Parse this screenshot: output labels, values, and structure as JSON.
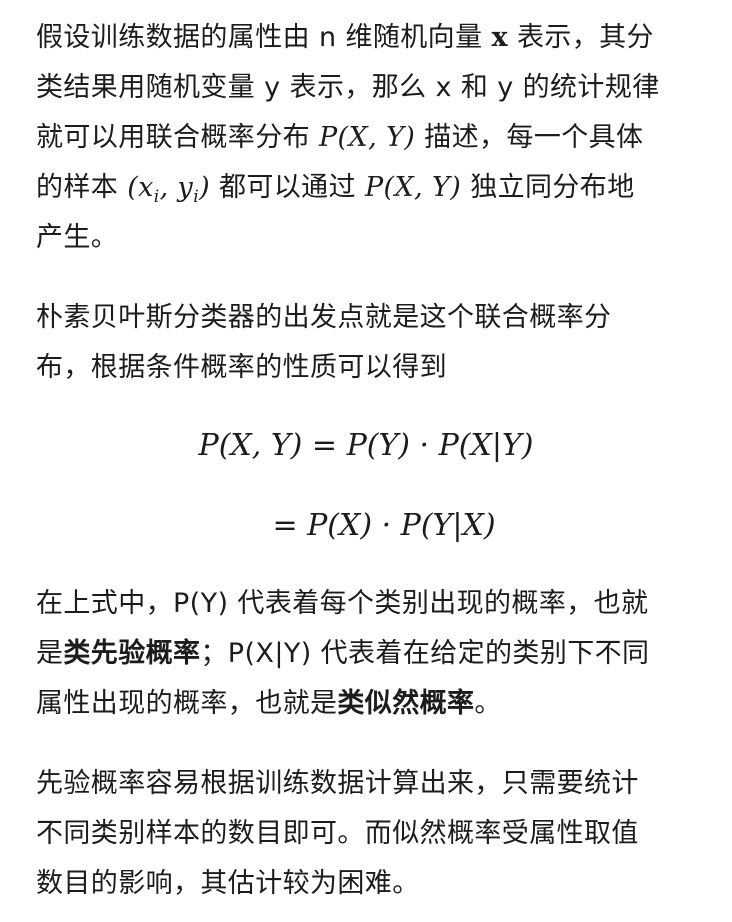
{
  "para1": {
    "line1_text": "假设训练数据的属性由 n 维随机向量 ",
    "line1_bold_var": "x",
    "line1_tail": " 表示，其分",
    "line2_text": "类结果用随机变量 y 表示，那么 x 和 y 的统计规律",
    "line3_head": "就可以用联合概率分布 ",
    "line3_math": "P(X, Y)",
    "line3_tail": " 描述，每一个具体",
    "line4_head": "的样本 ",
    "line4_math_open": "(x",
    "line4_sub_i1": "i",
    "line4_math_mid": ", y",
    "line4_sub_i2": "i",
    "line4_math_close": ")",
    "line4_mid": " 都可以通过 ",
    "line4_math2": "P(X, Y)",
    "line4_tail": " 独立同分布地",
    "line5_text": "产生。"
  },
  "para2": {
    "line1_text": "朴素贝叶斯分类器的出发点就是这个联合概率分",
    "line2_text": "布，根据条件概率的性质可以得到"
  },
  "equation": {
    "line1": "P(X, Y) = P(Y) · P(X|Y)",
    "line2": "= P(X) · P(Y|X)"
  },
  "para3": {
    "line1_text": "在上式中，P(Y) 代表着每个类别出现的概率，也就",
    "line2_head": "是",
    "line2_bold": "类先验概率",
    "line2_tail": "；P(X|Y) 代表着在给定的类别下不同",
    "line3_head": "属性出现的概率，也就是",
    "line3_bold": "类似然概率",
    "line3_tail": "。"
  },
  "para4": {
    "line1_text": "先验概率容易根据训练数据计算出来，只需要统计",
    "line2_text": "不同类别样本的数目即可。而似然概率受属性取值",
    "line3_text": "数目的影响，其估计较为困难。"
  }
}
